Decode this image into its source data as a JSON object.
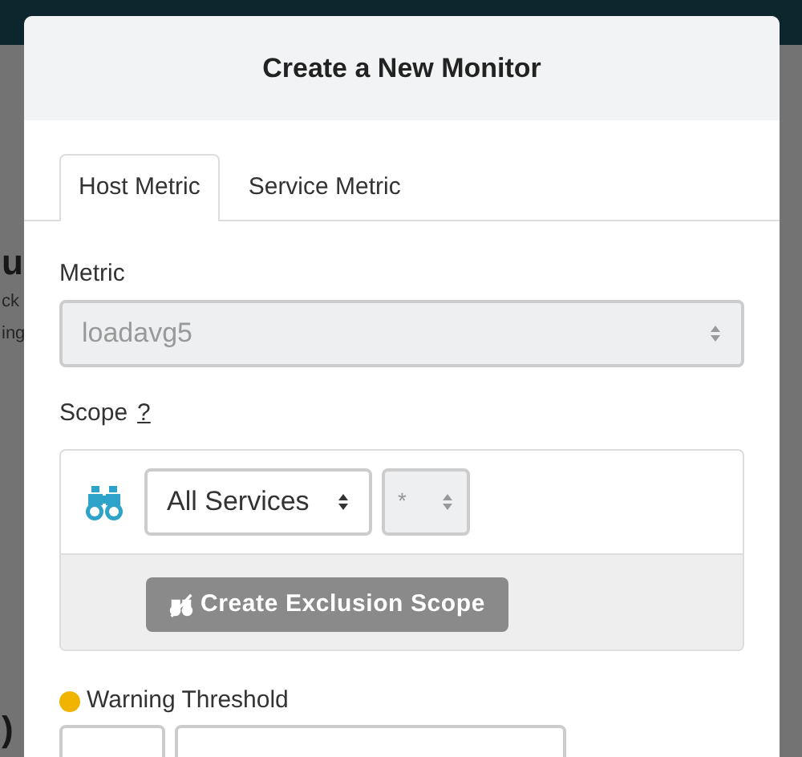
{
  "background": {
    "fragments": [
      {
        "text": "u",
        "kind": "heading"
      },
      {
        "text": "ck",
        "kind": "text"
      },
      {
        "text": "ing",
        "kind": "text"
      },
      {
        "text": ")",
        "kind": "footer"
      }
    ]
  },
  "modal": {
    "title": "Create a New Monitor",
    "tabs": [
      {
        "label": "Host Metric",
        "selected": true
      },
      {
        "label": "Service Metric",
        "selected": false
      }
    ],
    "metric": {
      "label": "Metric",
      "value": "loadavg5",
      "disabled": true
    },
    "scope": {
      "label": "Scope",
      "help": "?",
      "service_select": {
        "value": "All Services",
        "disabled": false
      },
      "role_select": {
        "value": "*",
        "disabled": true
      },
      "exclusion_button": "Create Exclusion Scope"
    },
    "warning": {
      "label": "Warning Threshold",
      "color": "#f0b400"
    }
  }
}
